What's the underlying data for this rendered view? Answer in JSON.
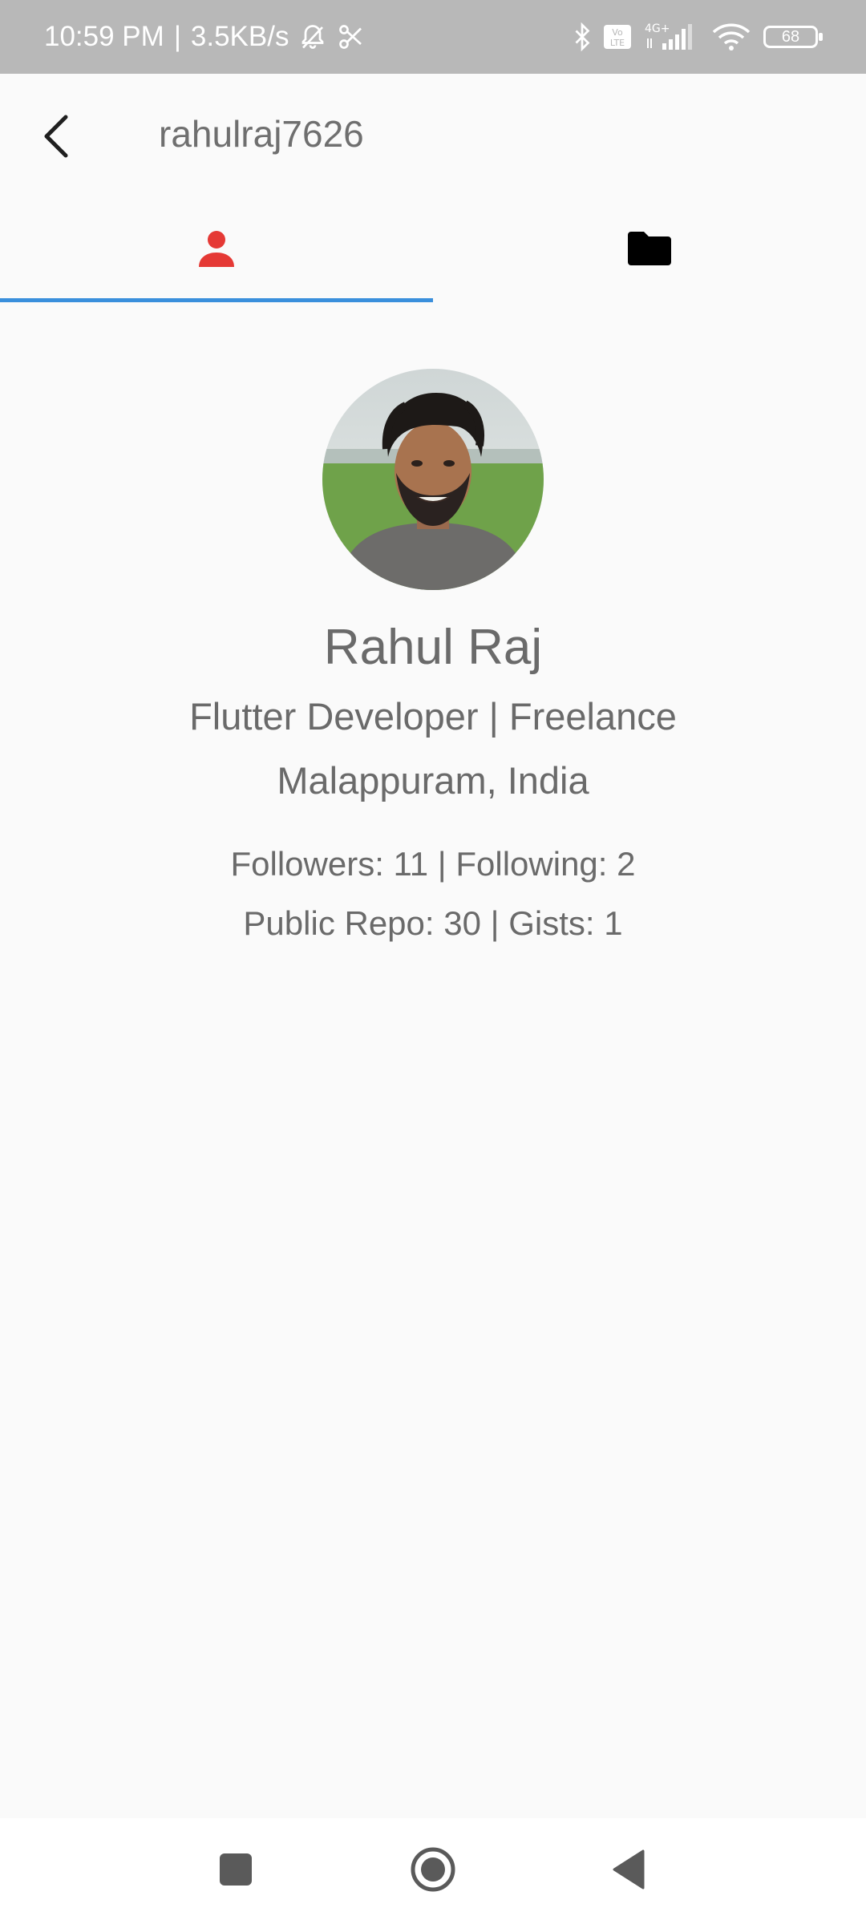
{
  "status_bar": {
    "time": "10:59 PM",
    "separator": "|",
    "speed": "3.5KB/s",
    "icons": [
      "mute-bell-icon",
      "scissors-icon",
      "bluetooth-icon",
      "volte-icon",
      "signal-4g-icon",
      "wifi-icon"
    ],
    "network_type": "4G+",
    "volte_label": "Vo LTE",
    "battery": "68"
  },
  "app_bar": {
    "title": "rahulraj7626",
    "back_icon": "back-arrow-icon"
  },
  "tabs": [
    {
      "name": "profile",
      "icon": "person-icon",
      "selected": true,
      "color": "#e53935"
    },
    {
      "name": "repositories",
      "icon": "folder-icon",
      "selected": false,
      "color": "#000000"
    }
  ],
  "profile": {
    "name": "Rahul Raj",
    "bio": "Flutter Developer | Freelance",
    "location": "Malappuram, India",
    "stats_line1": "Followers: 11 | Following: 2",
    "stats_line2": "Public Repo: 30 | Gists: 1"
  },
  "nav_bar": {
    "icons": [
      "recents-square-icon",
      "home-circle-icon",
      "back-triangle-icon"
    ]
  },
  "colors": {
    "status_bar": "#b8b8b8",
    "background": "#fafafa",
    "tab_indicator": "#3a8fdc",
    "selected_tab_icon": "#e53935",
    "text": "#6a6a6a"
  }
}
